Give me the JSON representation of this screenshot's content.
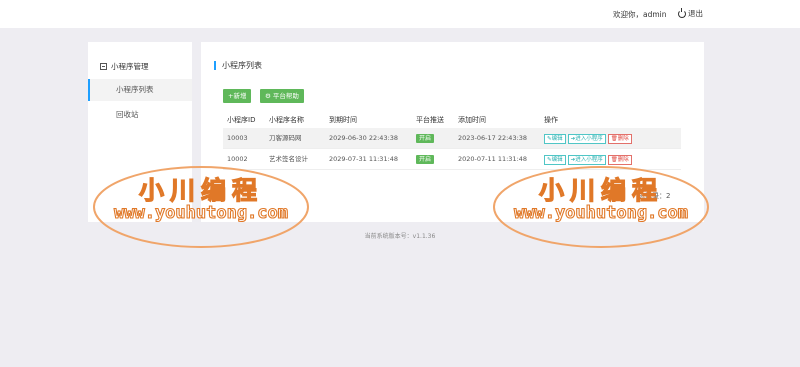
{
  "header": {
    "welcome": "欢迎你，admin",
    "logout_label": "退出"
  },
  "sidebar": {
    "section_label": "小程序管理",
    "items": [
      {
        "label": "小程序列表",
        "active": true
      },
      {
        "label": "回收站",
        "active": false
      }
    ]
  },
  "main": {
    "title": "小程序列表",
    "buttons": {
      "add_label": "+新增",
      "platform_label": "平台帮助"
    },
    "table": {
      "columns": [
        "小程序ID",
        "小程序名称",
        "到期时间",
        "平台推送",
        "添加时间",
        "操作"
      ],
      "rows": [
        {
          "id": "10003",
          "name": "刀客源码网",
          "expire": "2029-06-30 22:43:38",
          "push": "开启",
          "added": "2023-06-17 22:43:38"
        },
        {
          "id": "10002",
          "name": "艺术签名设计",
          "expire": "2029-07-31 11:31:48",
          "push": "开启",
          "added": "2020-07-11 11:31:48"
        }
      ],
      "actions": {
        "edit": "编辑",
        "enter": "进入小程序",
        "delete": "删除"
      }
    },
    "total": "总记录：2"
  },
  "footer": {
    "version": "当前系统版本号：v1.1.36"
  },
  "watermark": {
    "cn": "小川编程",
    "en": "www.youhutong.com",
    "color": "#e07828"
  }
}
